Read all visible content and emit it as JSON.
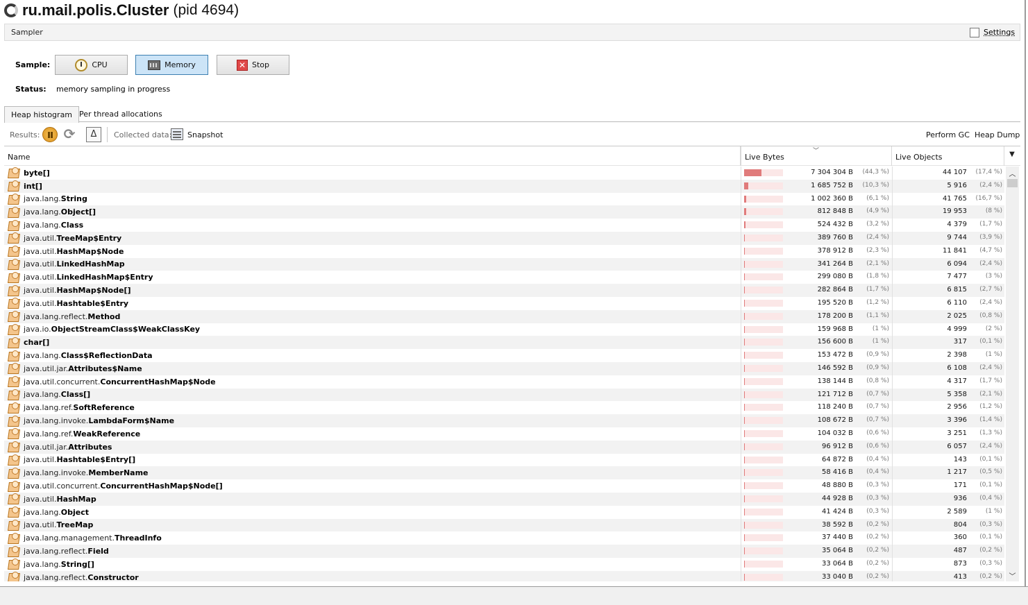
{
  "window": {
    "title": "ru.mail.polis.Cluster",
    "pid": "(pid 4694)"
  },
  "sampler": {
    "label": "Sampler",
    "settings_label": "Settings"
  },
  "controls": {
    "sample_label": "Sample:",
    "cpu_label": "CPU",
    "memory_label": "Memory",
    "stop_label": "Stop",
    "status_label": "Status:",
    "status_value": "memory sampling in progress"
  },
  "tabs": [
    {
      "label": "Heap histogram",
      "selected": true
    },
    {
      "label": "Per thread allocations",
      "selected": false
    }
  ],
  "results_bar": {
    "results_label": "Results:",
    "collected_label": "Collected data:",
    "snapshot_label": "Snapshot",
    "perform_gc_label": "Perform GC",
    "heap_dump_label": "Heap Dump"
  },
  "table": {
    "columns": {
      "name": "Name",
      "live_bytes": "Live Bytes",
      "live_objects": "Live Objects"
    },
    "rows": [
      {
        "pkg": "",
        "cls": "byte[]",
        "bytes": "7 304 304 B",
        "bytes_pct": "(44,3 %)",
        "bytes_frac": 0.443,
        "objects": "44 107",
        "objects_pct": "(17,4 %)"
      },
      {
        "pkg": "",
        "cls": "int[]",
        "bytes": "1 685 752 B",
        "bytes_pct": "(10,3 %)",
        "bytes_frac": 0.103,
        "objects": "5 916",
        "objects_pct": "(2,4 %)"
      },
      {
        "pkg": "java.lang.",
        "cls": "String",
        "bytes": "1 002 360 B",
        "bytes_pct": "(6,1 %)",
        "bytes_frac": 0.061,
        "objects": "41 765",
        "objects_pct": "(16,7 %)"
      },
      {
        "pkg": "java.lang.",
        "cls": "Object[]",
        "bytes": "812 848 B",
        "bytes_pct": "(4,9 %)",
        "bytes_frac": 0.049,
        "objects": "19 953",
        "objects_pct": "(8 %)"
      },
      {
        "pkg": "java.lang.",
        "cls": "Class",
        "bytes": "524 432 B",
        "bytes_pct": "(3,2 %)",
        "bytes_frac": 0.032,
        "objects": "4 379",
        "objects_pct": "(1,7 %)"
      },
      {
        "pkg": "java.util.",
        "cls": "TreeMap$Entry",
        "bytes": "389 760 B",
        "bytes_pct": "(2,4 %)",
        "bytes_frac": 0.024,
        "objects": "9 744",
        "objects_pct": "(3,9 %)"
      },
      {
        "pkg": "java.util.",
        "cls": "HashMap$Node",
        "bytes": "378 912 B",
        "bytes_pct": "(2,3 %)",
        "bytes_frac": 0.023,
        "objects": "11 841",
        "objects_pct": "(4,7 %)"
      },
      {
        "pkg": "java.util.",
        "cls": "LinkedHashMap",
        "bytes": "341 264 B",
        "bytes_pct": "(2,1 %)",
        "bytes_frac": 0.021,
        "objects": "6 094",
        "objects_pct": "(2,4 %)"
      },
      {
        "pkg": "java.util.",
        "cls": "LinkedHashMap$Entry",
        "bytes": "299 080 B",
        "bytes_pct": "(1,8 %)",
        "bytes_frac": 0.018,
        "objects": "7 477",
        "objects_pct": "(3 %)"
      },
      {
        "pkg": "java.util.",
        "cls": "HashMap$Node[]",
        "bytes": "282 864 B",
        "bytes_pct": "(1,7 %)",
        "bytes_frac": 0.017,
        "objects": "6 815",
        "objects_pct": "(2,7 %)"
      },
      {
        "pkg": "java.util.",
        "cls": "Hashtable$Entry",
        "bytes": "195 520 B",
        "bytes_pct": "(1,2 %)",
        "bytes_frac": 0.012,
        "objects": "6 110",
        "objects_pct": "(2,4 %)"
      },
      {
        "pkg": "java.lang.reflect. ",
        "cls": "Method",
        "bytes": "178 200 B",
        "bytes_pct": "(1,1 %)",
        "bytes_frac": 0.011,
        "objects": "2 025",
        "objects_pct": "(0,8 %)"
      },
      {
        "pkg": "java.io. ",
        "cls": "ObjectStreamClass$WeakClassKey",
        "bytes": "159 968 B",
        "bytes_pct": "(1 %)",
        "bytes_frac": 0.01,
        "objects": "4 999",
        "objects_pct": "(2 %)"
      },
      {
        "pkg": "",
        "cls": "char[]",
        "bytes": "156 600 B",
        "bytes_pct": "(1 %)",
        "bytes_frac": 0.01,
        "objects": "317",
        "objects_pct": "(0,1 %)"
      },
      {
        "pkg": "java.lang. ",
        "cls": "Class$ReflectionData",
        "bytes": "153 472 B",
        "bytes_pct": "(0,9 %)",
        "bytes_frac": 0.009,
        "objects": "2 398",
        "objects_pct": "(1 %)"
      },
      {
        "pkg": "java.util.jar. ",
        "cls": "Attributes$Name",
        "bytes": "146 592 B",
        "bytes_pct": "(0,9 %)",
        "bytes_frac": 0.009,
        "objects": "6 108",
        "objects_pct": "(2,4 %)"
      },
      {
        "pkg": "java.util.concurrent. ",
        "cls": "ConcurrentHashMap$Node",
        "bytes": "138 144 B",
        "bytes_pct": "(0,8 %)",
        "bytes_frac": 0.008,
        "objects": "4 317",
        "objects_pct": "(1,7 %)"
      },
      {
        "pkg": "java.lang. ",
        "cls": "Class[]",
        "bytes": "121 712 B",
        "bytes_pct": "(0,7 %)",
        "bytes_frac": 0.007,
        "objects": "5 358",
        "objects_pct": "(2,1 %)"
      },
      {
        "pkg": "java.lang.ref. ",
        "cls": "SoftReference",
        "bytes": "118 240 B",
        "bytes_pct": "(0,7 %)",
        "bytes_frac": 0.007,
        "objects": "2 956",
        "objects_pct": "(1,2 %)"
      },
      {
        "pkg": "java.lang.invoke. ",
        "cls": "LambdaForm$Name",
        "bytes": "108 672 B",
        "bytes_pct": "(0,7 %)",
        "bytes_frac": 0.007,
        "objects": "3 396",
        "objects_pct": "(1,4 %)"
      },
      {
        "pkg": "java.lang.ref. ",
        "cls": "WeakReference",
        "bytes": "104 032 B",
        "bytes_pct": "(0,6 %)",
        "bytes_frac": 0.006,
        "objects": "3 251",
        "objects_pct": "(1,3 %)"
      },
      {
        "pkg": "java.util.jar. ",
        "cls": "Attributes",
        "bytes": "96 912 B",
        "bytes_pct": "(0,6 %)",
        "bytes_frac": 0.006,
        "objects": "6 057",
        "objects_pct": "(2,4 %)"
      },
      {
        "pkg": "java.util.",
        "cls": "Hashtable$Entry[]",
        "bytes": "64 872 B",
        "bytes_pct": "(0,4 %)",
        "bytes_frac": 0.004,
        "objects": "143",
        "objects_pct": "(0,1 %)"
      },
      {
        "pkg": "java.lang.invoke. ",
        "cls": "MemberName",
        "bytes": "58 416 B",
        "bytes_pct": "(0,4 %)",
        "bytes_frac": 0.004,
        "objects": "1 217",
        "objects_pct": "(0,5 %)"
      },
      {
        "pkg": "java.util.concurrent. ",
        "cls": "ConcurrentHashMap$Node[]",
        "bytes": "48 880 B",
        "bytes_pct": "(0,3 %)",
        "bytes_frac": 0.003,
        "objects": "171",
        "objects_pct": "(0,1 %)"
      },
      {
        "pkg": "java.util.",
        "cls": "HashMap",
        "bytes": "44 928 B",
        "bytes_pct": "(0,3 %)",
        "bytes_frac": 0.003,
        "objects": "936",
        "objects_pct": "(0,4 %)"
      },
      {
        "pkg": "java.lang. ",
        "cls": "Object",
        "bytes": "41 424 B",
        "bytes_pct": "(0,3 %)",
        "bytes_frac": 0.003,
        "objects": "2 589",
        "objects_pct": "(1 %)"
      },
      {
        "pkg": "java.util.",
        "cls": "TreeMap",
        "bytes": "38 592 B",
        "bytes_pct": "(0,2 %)",
        "bytes_frac": 0.002,
        "objects": "804",
        "objects_pct": "(0,3 %)"
      },
      {
        "pkg": "java.lang.management.  ",
        "cls": "ThreadInfo",
        "bytes": "37 440 B",
        "bytes_pct": "(0,2 %)",
        "bytes_frac": 0.002,
        "objects": "360",
        "objects_pct": "(0,1 %)"
      },
      {
        "pkg": "java.lang.reflect. ",
        "cls": "Field",
        "bytes": "35 064 B",
        "bytes_pct": "(0,2 %)",
        "bytes_frac": 0.002,
        "objects": "487",
        "objects_pct": "(0,2 %)"
      },
      {
        "pkg": "java.lang. ",
        "cls": "String[]",
        "bytes": "33 064 B",
        "bytes_pct": "(0,2 %)",
        "bytes_frac": 0.002,
        "objects": "873",
        "objects_pct": "(0,3 %)"
      },
      {
        "pkg": "java.lang.reflect. ",
        "cls": "Constructor",
        "bytes": "33 040 B",
        "bytes_pct": "(0,2 %)",
        "bytes_frac": 0.002,
        "objects": "413",
        "objects_pct": "(0,2 %)"
      }
    ]
  },
  "colors": {
    "bar_fill": "#e07b7b",
    "bar_track": "#fbe7e7",
    "active_button": "#cce4f7"
  }
}
